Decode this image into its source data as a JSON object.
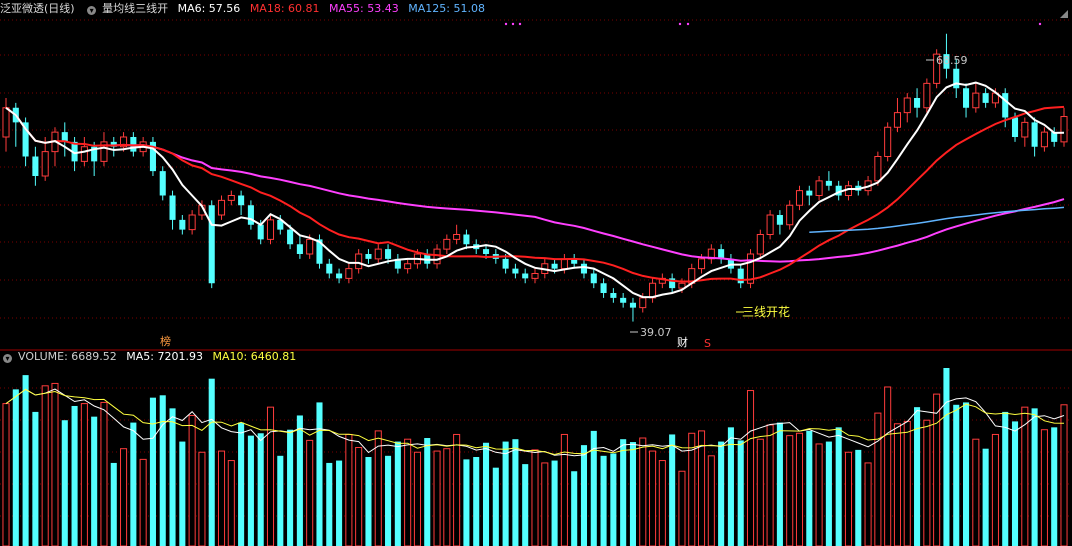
{
  "header": {
    "stock_name": "泛亚微透",
    "period": "(日线)",
    "indicator_name": "量均线三线开",
    "ma6_label": "MA6: 57.56",
    "ma18_label": "MA18: 60.81",
    "ma55_label": "MA55: 53.43",
    "ma125_label": "MA125: 51.08"
  },
  "volume_header": {
    "title": "VOLUME: 6689.52",
    "ma5_label": "MA5: 7201.93",
    "ma10_label": "MA10: 6460.81"
  },
  "annotations": {
    "high_label": "68.59",
    "low_label": "39.07",
    "signal_label": "三线开花",
    "marker_bang": "榜",
    "marker_cai": "财",
    "marker_s": "S"
  },
  "colors": {
    "up": "#ff3c3c",
    "down": "#54ffff",
    "ma6": "#ffffff",
    "ma18": "#ff2020",
    "ma55": "#ff40ff",
    "ma125": "#60b4ff",
    "vol_ma5": "#ffffff",
    "vol_ma10": "#ffff40",
    "grid": "#7a0000",
    "label_yellow": "#ffff40"
  },
  "chart_data": [
    {
      "type": "candlestick",
      "title": "泛亚微透(日线)",
      "price_range": [
        39.07,
        68.59
      ],
      "high": 68.59,
      "low": 39.07,
      "close_last": 60.1,
      "candles": [
        [
          58.0,
          61.0,
          62.0,
          56.5
        ],
        [
          61.0,
          59.5,
          61.5,
          57.0
        ],
        [
          59.5,
          56.0,
          60.0,
          55.0
        ],
        [
          56.0,
          54.0,
          57.0,
          53.0
        ],
        [
          54.0,
          56.5,
          58.0,
          53.5
        ],
        [
          56.5,
          58.5,
          59.0,
          55.0
        ],
        [
          58.5,
          57.5,
          59.5,
          56.0
        ],
        [
          57.5,
          55.5,
          58.0,
          54.5
        ],
        [
          55.5,
          57.0,
          58.0,
          55.0
        ],
        [
          57.0,
          55.5,
          57.5,
          54.0
        ],
        [
          55.5,
          57.5,
          58.5,
          55.0
        ],
        [
          57.5,
          57.0,
          58.0,
          56.0
        ],
        [
          57.0,
          58.0,
          58.5,
          56.5
        ],
        [
          58.0,
          56.5,
          58.5,
          56.0
        ],
        [
          56.5,
          57.5,
          58.0,
          56.0
        ],
        [
          57.5,
          54.5,
          58.0,
          54.0
        ],
        [
          54.5,
          52.0,
          55.0,
          51.5
        ],
        [
          52.0,
          49.5,
          52.5,
          48.5
        ],
        [
          49.5,
          48.5,
          50.0,
          48.0
        ],
        [
          48.5,
          50.0,
          50.5,
          48.0
        ],
        [
          50.0,
          51.0,
          51.5,
          49.5
        ],
        [
          51.0,
          43.0,
          51.5,
          42.5
        ],
        [
          50.0,
          51.5,
          52.0,
          49.5
        ],
        [
          51.5,
          52.0,
          52.5,
          51.0
        ],
        [
          52.0,
          51.0,
          52.5,
          50.0
        ],
        [
          51.0,
          49.0,
          51.5,
          48.5
        ],
        [
          49.0,
          47.5,
          49.5,
          47.0
        ],
        [
          47.5,
          49.5,
          50.0,
          47.0
        ],
        [
          49.5,
          48.5,
          50.0,
          48.0
        ],
        [
          48.5,
          47.0,
          49.0,
          46.5
        ],
        [
          47.0,
          46.0,
          48.0,
          45.5
        ],
        [
          46.0,
          47.5,
          48.0,
          45.5
        ],
        [
          47.5,
          45.0,
          48.0,
          44.5
        ],
        [
          45.0,
          44.0,
          45.5,
          43.5
        ],
        [
          44.0,
          43.5,
          44.5,
          43.0
        ],
        [
          43.5,
          44.5,
          45.0,
          43.0
        ],
        [
          44.5,
          46.0,
          46.5,
          44.0
        ],
        [
          46.0,
          45.5,
          46.5,
          45.0
        ],
        [
          45.5,
          46.5,
          47.0,
          45.0
        ],
        [
          46.5,
          45.5,
          47.0,
          45.0
        ],
        [
          45.5,
          44.5,
          46.0,
          44.0
        ],
        [
          44.5,
          45.0,
          45.5,
          44.0
        ],
        [
          45.0,
          46.0,
          46.5,
          44.5
        ],
        [
          46.0,
          45.0,
          46.5,
          44.5
        ],
        [
          45.0,
          46.5,
          47.0,
          44.5
        ],
        [
          46.5,
          47.5,
          48.0,
          46.0
        ],
        [
          47.5,
          48.0,
          49.0,
          47.0
        ],
        [
          48.0,
          47.0,
          48.5,
          46.5
        ],
        [
          47.0,
          46.5,
          47.5,
          46.0
        ],
        [
          46.5,
          46.0,
          47.0,
          45.5
        ],
        [
          46.0,
          45.5,
          46.5,
          45.0
        ],
        [
          45.5,
          44.5,
          46.0,
          44.0
        ],
        [
          44.5,
          44.0,
          45.0,
          43.5
        ],
        [
          44.0,
          43.5,
          44.5,
          43.0
        ],
        [
          43.5,
          44.0,
          44.5,
          43.0
        ],
        [
          44.0,
          45.0,
          45.5,
          43.5
        ],
        [
          45.0,
          44.5,
          45.5,
          44.0
        ],
        [
          44.5,
          45.5,
          46.0,
          44.0
        ],
        [
          45.5,
          45.0,
          46.0,
          44.5
        ],
        [
          45.0,
          44.0,
          45.5,
          43.5
        ],
        [
          44.0,
          43.0,
          44.5,
          42.5
        ],
        [
          43.0,
          42.0,
          43.5,
          41.5
        ],
        [
          42.0,
          41.5,
          42.5,
          41.0
        ],
        [
          41.5,
          41.0,
          42.0,
          40.5
        ],
        [
          41.0,
          40.5,
          41.5,
          39.07
        ],
        [
          40.5,
          41.5,
          42.0,
          40.0
        ],
        [
          41.5,
          43.0,
          43.5,
          41.0
        ],
        [
          43.0,
          43.5,
          44.0,
          42.5
        ],
        [
          43.5,
          42.5,
          44.0,
          42.0
        ],
        [
          42.5,
          43.0,
          43.5,
          42.0
        ],
        [
          43.0,
          44.5,
          45.0,
          42.5
        ],
        [
          44.5,
          45.5,
          46.0,
          44.0
        ],
        [
          45.5,
          46.5,
          47.0,
          45.0
        ],
        [
          46.5,
          45.5,
          47.0,
          45.0
        ],
        [
          45.5,
          44.5,
          46.0,
          44.0
        ],
        [
          44.5,
          43.0,
          45.0,
          42.5
        ],
        [
          43.0,
          46.0,
          46.5,
          42.5
        ],
        [
          46.0,
          48.0,
          48.5,
          45.5
        ],
        [
          48.0,
          50.0,
          50.5,
          47.5
        ],
        [
          50.0,
          49.0,
          50.5,
          48.0
        ],
        [
          49.0,
          51.0,
          51.5,
          48.5
        ],
        [
          51.0,
          52.5,
          53.0,
          50.5
        ],
        [
          52.5,
          52.0,
          53.0,
          51.0
        ],
        [
          52.0,
          53.5,
          54.0,
          51.5
        ],
        [
          53.5,
          53.0,
          54.5,
          52.5
        ],
        [
          53.0,
          52.0,
          53.5,
          51.5
        ],
        [
          52.0,
          53.0,
          53.5,
          51.5
        ],
        [
          53.0,
          52.5,
          53.5,
          52.0
        ],
        [
          52.5,
          53.5,
          54.0,
          52.0
        ],
        [
          53.5,
          56.0,
          56.5,
          53.0
        ],
        [
          56.0,
          59.0,
          59.5,
          55.5
        ],
        [
          59.0,
          60.5,
          62.0,
          58.5
        ],
        [
          60.5,
          62.0,
          62.5,
          59.5
        ],
        [
          62.0,
          61.0,
          63.0,
          60.0
        ],
        [
          61.0,
          63.5,
          64.0,
          60.5
        ],
        [
          63.5,
          66.5,
          67.0,
          63.0
        ],
        [
          66.5,
          65.0,
          68.59,
          64.0
        ],
        [
          65.0,
          63.0,
          66.0,
          62.0
        ],
        [
          63.0,
          61.0,
          63.5,
          60.0
        ],
        [
          61.0,
          62.5,
          63.5,
          60.5
        ],
        [
          62.5,
          61.5,
          63.0,
          61.0
        ],
        [
          61.5,
          62.5,
          63.0,
          61.0
        ],
        [
          62.5,
          60.0,
          63.0,
          59.0
        ],
        [
          60.0,
          58.0,
          60.5,
          57.5
        ],
        [
          58.0,
          59.5,
          60.0,
          57.0
        ],
        [
          59.5,
          57.0,
          60.0,
          56.0
        ],
        [
          57.0,
          58.5,
          59.0,
          56.5
        ],
        [
          58.5,
          57.5,
          59.0,
          57.0
        ],
        [
          57.5,
          60.1,
          61.0,
          57.0
        ]
      ],
      "series_names": [
        "MA6",
        "MA18",
        "MA55",
        "MA125"
      ]
    },
    {
      "type": "bar",
      "title": "VOLUME",
      "values_hint": "relative heights",
      "series_names": [
        "VOLUME",
        "MA5",
        "MA10"
      ]
    }
  ]
}
